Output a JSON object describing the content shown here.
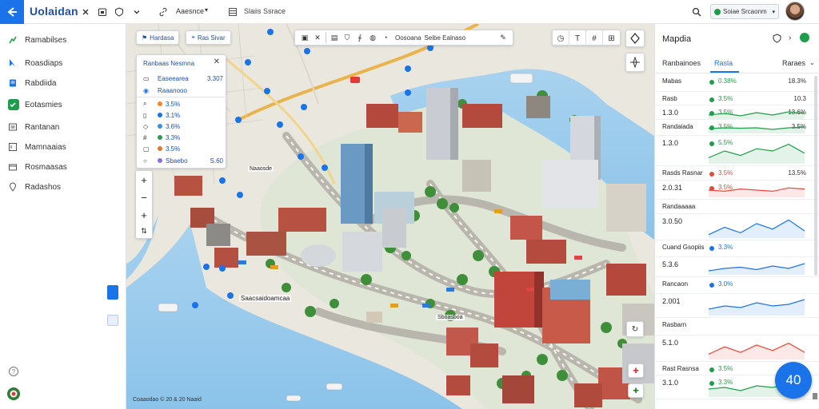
{
  "app": {
    "title": "Uolaidan",
    "logo_icon": "chevron-left-arrow-icon",
    "accent": "#1a73e8"
  },
  "topbar": {
    "filter_label": "Aaesnce",
    "layers_label": "Slaiis Ssrace",
    "status_value": "Soiae Srcaonm",
    "search_icon": "search-icon"
  },
  "sidebar": {
    "items": [
      {
        "label": "Ramabilses",
        "icon": "route-icon"
      },
      {
        "label": "Roasdiaps",
        "icon": "cursor-icon"
      },
      {
        "label": "Rabdiida",
        "icon": "document-icon"
      },
      {
        "label": "Eotasmies",
        "icon": "check-square-icon",
        "active": true
      },
      {
        "label": "Rantanan",
        "icon": "list-icon"
      },
      {
        "label": "Mamnaaias",
        "icon": "window-icon"
      },
      {
        "label": "Rosmaasas",
        "icon": "box-icon"
      },
      {
        "label": "Radashos",
        "icon": "pin-icon"
      }
    ]
  },
  "map": {
    "tabs": [
      {
        "label": "Hardasa"
      },
      {
        "label": "Ras Sivar"
      }
    ],
    "toolbar_labels": [
      "Oosoana",
      "Seibe Ealnaso"
    ],
    "layer_panel": {
      "title": "Ranbaas Nesmna",
      "rows": [
        {
          "label": "Easeearea",
          "value": "3.307",
          "icon": "folder-icon"
        },
        {
          "label": "Raaanooo",
          "value": "",
          "icon": "globe-icon"
        },
        {
          "label": "3.5%",
          "value": "",
          "icon": "search-icon"
        },
        {
          "label": "3.1%",
          "value": "",
          "icon": "doc-icon"
        },
        {
          "label": "3.6%",
          "value": "",
          "icon": "tag-icon"
        },
        {
          "label": "3.3%",
          "value": "",
          "icon": "hash-icon"
        },
        {
          "label": "3.5%",
          "value": "",
          "icon": "box-icon"
        },
        {
          "label": "Sbaebo",
          "value": "S.60",
          "icon": "circle-icon"
        }
      ]
    },
    "address_label": "Saacsaidoamcaa",
    "poi_label": "Sboasboa",
    "small_label": "Naaosde",
    "scale_label": "Coaaodao © 20 & 20 Naaid"
  },
  "right_panel": {
    "title": "Mapdia",
    "tabs": [
      "Ranbainoes",
      "Rasla",
      "Raraes"
    ],
    "active_tab": 1,
    "rows": [
      {
        "name": "Mabas",
        "big": "",
        "pct": "0.38%",
        "val": "18.3%",
        "color": "#1e9e4a"
      },
      {
        "name": "Rasb",
        "big": "",
        "pct": "3.5%",
        "val": "10.3",
        "color": "#1e9e4a"
      },
      {
        "name": "",
        "big": "1.3.0",
        "pct": "3.5%",
        "val": "13.6%",
        "color": "#1e9e4a"
      },
      {
        "name": "Randaiada",
        "big": "",
        "pct": "3.5%",
        "val": "3.5%",
        "color": "#1e9e4a"
      },
      {
        "name": "",
        "big": "1.3.0",
        "pct": "5.5%",
        "val": "",
        "color": "#1e9e4a"
      },
      {
        "name": "Rasds Rasnar",
        "big": "",
        "pct": "3.5%",
        "val": "13.5%",
        "color": "#e8473b"
      },
      {
        "name": "",
        "big": "2.0.31",
        "pct": "3.5%",
        "val": "",
        "color": "#e8473b"
      },
      {
        "name": "Randaaaaa",
        "big": "",
        "pct": "",
        "val": "",
        "color": "#1a73e8"
      },
      {
        "name": "",
        "big": "3.0.50",
        "pct": "",
        "val": "",
        "color": "#1a73e8"
      },
      {
        "name": "Cuand Gsopiis",
        "big": "",
        "pct": "3.3%",
        "val": "",
        "color": "#1a73e8"
      },
      {
        "name": "",
        "big": "5.3.6",
        "pct": "",
        "val": "",
        "color": "#1a73e8"
      },
      {
        "name": "Rancaon",
        "big": "",
        "pct": "3.0%",
        "val": "",
        "color": "#1a73e8"
      },
      {
        "name": "",
        "big": "2.001",
        "pct": "",
        "val": "",
        "color": "#1a73e8"
      },
      {
        "name": "Rasbarn",
        "big": "",
        "pct": "",
        "val": "",
        "color": "#e8473b"
      },
      {
        "name": "",
        "big": "5.1.0",
        "pct": "",
        "val": "",
        "color": "#e8473b"
      },
      {
        "name": "Rast Rasnsa",
        "big": "",
        "pct": "3.5%",
        "val": "",
        "color": "#1e9e4a"
      },
      {
        "name": "",
        "big": "3.1.0",
        "pct": "3.3%",
        "val": "",
        "color": "#1e9e4a"
      }
    ],
    "fab_count": "40"
  }
}
